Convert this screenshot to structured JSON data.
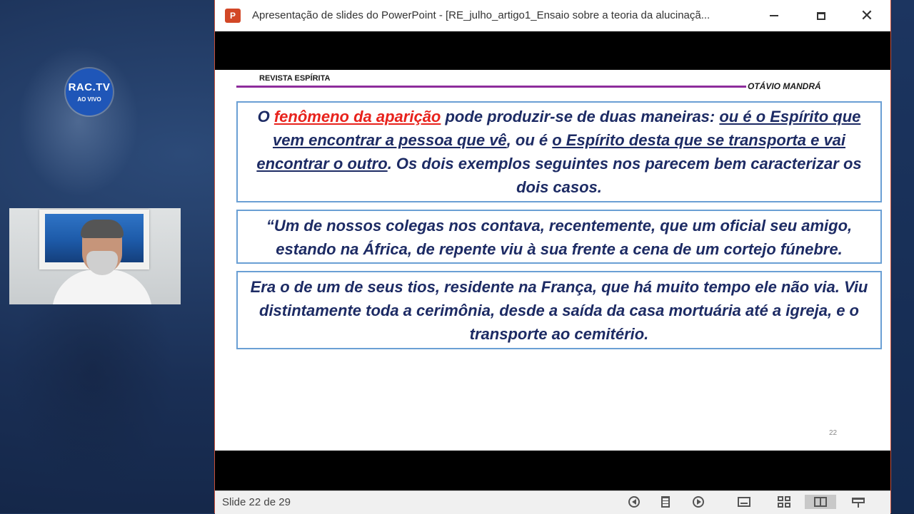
{
  "overlay": {
    "logo_brand": "RAC.TV",
    "logo_live": "AO VIVO"
  },
  "window": {
    "title": "Apresentação de slides do PowerPoint - [RE_julho_artigo1_Ensaio sobre a teoria da alucinaçã...",
    "app_icon": "P"
  },
  "slide": {
    "header_left": "REVISTA ESPÍRITA",
    "header_right": "OTÁVIO MANDRÁ",
    "box1": {
      "part1": "O ",
      "part2": "fenômeno da aparição",
      "part3": " pode produzir-se de duas maneiras: ",
      "part4": "ou é o Espírito que vem encontrar a pessoa que vê",
      "part5": ", ou é ",
      "part6": "o Espírito desta que se transporta e vai encontrar o outro",
      "part7": ". Os dois exemplos seguintes nos parecem bem caracterizar os dois casos."
    },
    "box2": "“Um de nossos colegas nos contava, recentemente, que um oficial seu amigo, estando na África, de repente viu à sua frente a cena de um cortejo fúnebre.",
    "box3": "Era o de um de seus tios, residente na França, que há muito tempo ele não via. Viu distintamente toda a cerimônia, desde a saída da casa mortuária até a igreja, e o transporte ao cemitério.",
    "page_number": "22"
  },
  "statusbar": {
    "slide_counter": "Slide 22 de 29"
  },
  "colors": {
    "accent_red": "#e8221c",
    "text_navy": "#1d2b64",
    "header_line": "#8e2d9c",
    "box_border": "#6a9fd4"
  }
}
